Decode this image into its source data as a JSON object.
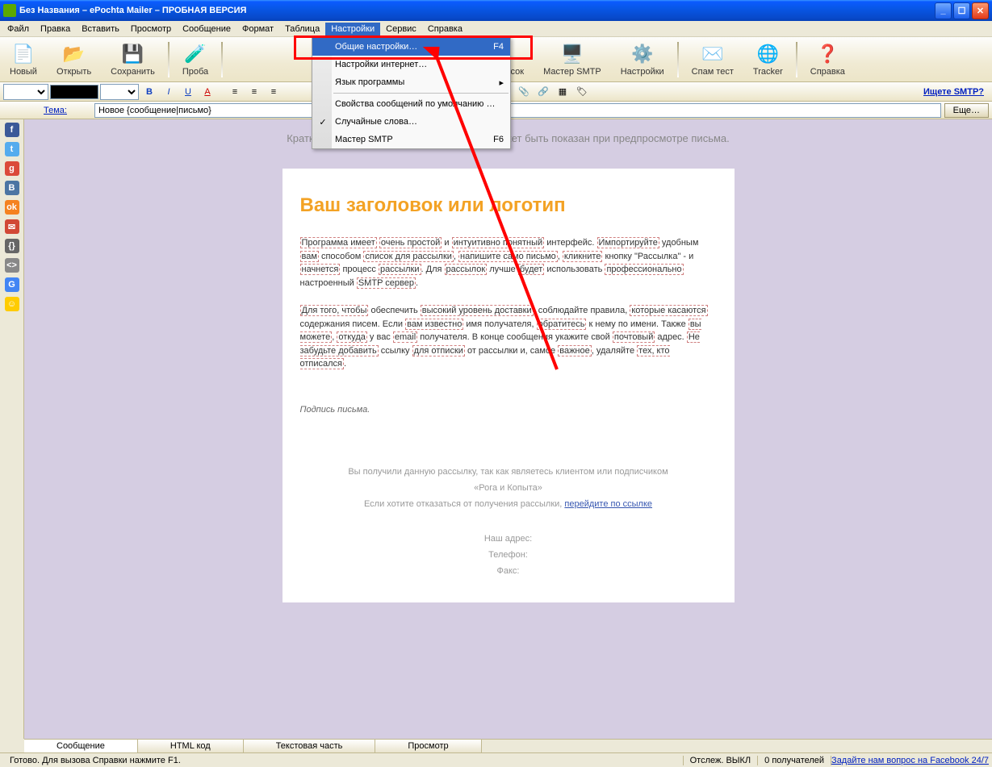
{
  "window": {
    "title": "Без Названия – ePochta Mailer – ПРОБНАЯ ВЕРСИЯ"
  },
  "menu": {
    "items": [
      "Файл",
      "Правка",
      "Вставить",
      "Просмотр",
      "Сообщение",
      "Формат",
      "Таблица",
      "Настройки",
      "Сервис",
      "Справка"
    ],
    "open_index": 7
  },
  "dropdown": {
    "items": [
      {
        "label": "Общие настройки…",
        "shortcut": "F4",
        "hl": true
      },
      {
        "label": "Настройки интернет…"
      },
      {
        "label": "Язык программы",
        "submenu": true
      },
      {
        "sep": true
      },
      {
        "label": "Свойства сообщений по умолчанию …"
      },
      {
        "label": "Случайные слова…",
        "icon": "✓"
      },
      {
        "label": "Мастер SMTP",
        "shortcut": "F6"
      }
    ]
  },
  "toolbar": [
    {
      "icon": "📄",
      "label": "Новый"
    },
    {
      "icon": "📂",
      "label": "Открыть"
    },
    {
      "icon": "💾",
      "label": "Сохранить"
    },
    {
      "sep": true
    },
    {
      "icon": "🧪",
      "label": "Проба"
    },
    {
      "sep": true
    },
    {
      "spacer": 280
    },
    {
      "icon": "⚠️",
      "label": "Черный список"
    },
    {
      "icon": "🖥️",
      "label": "Мастер SMTP"
    },
    {
      "icon": "⚙️",
      "label": "Настройки"
    },
    {
      "sep": true
    },
    {
      "icon": "✉️",
      "label": "Спам тест"
    },
    {
      "icon": "🌐",
      "label": "Tracker"
    },
    {
      "sep": true
    },
    {
      "icon": "❓",
      "label": "Справка"
    }
  ],
  "fmtbar": {
    "smtp_link": "Ищете SMTP?"
  },
  "subject": {
    "label": "Тема:",
    "value": "Новое {сообщение|письмо}",
    "more": "Еще…"
  },
  "sidebar_colors": [
    "#3b5998",
    "#55acee",
    "#db4a39",
    "#4c75a3",
    "#f58220",
    "#d14836",
    "#666",
    "#888",
    "#4285f4",
    "#ffcc00"
  ],
  "sidebar_letters": [
    "f",
    "t",
    "g",
    "B",
    "ok",
    "✉",
    "{}",
    "<>",
    "G",
    "☺"
  ],
  "doc": {
    "desc": "Краткое описание сообщения. Этот текст может быть показан при предпросмотре письма.",
    "heading": "Ваш заголовок или логотип",
    "p1_parts": [
      "Программа имеет",
      " ",
      "очень простой",
      " и ",
      "интуитивно понятный",
      " интерфейс. ",
      "Импортируйте",
      " удобным ",
      "вам",
      " способом ",
      "список для рассылки",
      ", ",
      "напишите само письмо",
      ", ",
      "кликните",
      " кнопку \"Рассылка\" - и ",
      "начнется",
      " процесс ",
      "рассылки",
      ". Для ",
      "рассылок",
      " лучше ",
      "будет",
      " использовать ",
      "профессионально",
      " настроенный ",
      "SMTP сервер",
      "."
    ],
    "p2_parts": [
      "Для того, чтобы",
      " обеспечить ",
      "высокий уровень доставки",
      ", соблюдайте правила, ",
      "которые касаются",
      " содержания писем. Если ",
      "вам известно",
      " имя получателя, ",
      "обратитесь",
      " к нему по имени. Также ",
      "вы можете",
      ", ",
      "откуда",
      " у вас ",
      "email",
      " получателя. В конце сообщения укажите свой ",
      "почтовый",
      "  адрес. ",
      "Не забудьте добавить",
      " ссылку ",
      "для отписки",
      " от рассылки и, самое ",
      "важное",
      ", удаляйте ",
      "тех, кто отписался",
      "."
    ],
    "sig": "Подпись письма.",
    "foot1": "Вы получили данную рассылку, так как являетесь клиентом или подписчиком",
    "foot2": "«Рога и Копыта»",
    "foot3a": "Если хотите отказаться от получения рассылки, ",
    "foot3b": "перейдите по ссылке",
    "addr": "Наш адрес:",
    "tel": "Телефон:",
    "fax": "Факс:"
  },
  "tabs": [
    "Сообщение",
    "HTML код",
    "Текстовая часть",
    "Просмотр"
  ],
  "status": {
    "ready": "Готово. Для вызова Справки нажмите F1.",
    "track": "Отслеж. ВЫКЛ",
    "rcpt": "0 получателей",
    "fb": "Задайте нам вопрос на Facebook 24/7"
  }
}
